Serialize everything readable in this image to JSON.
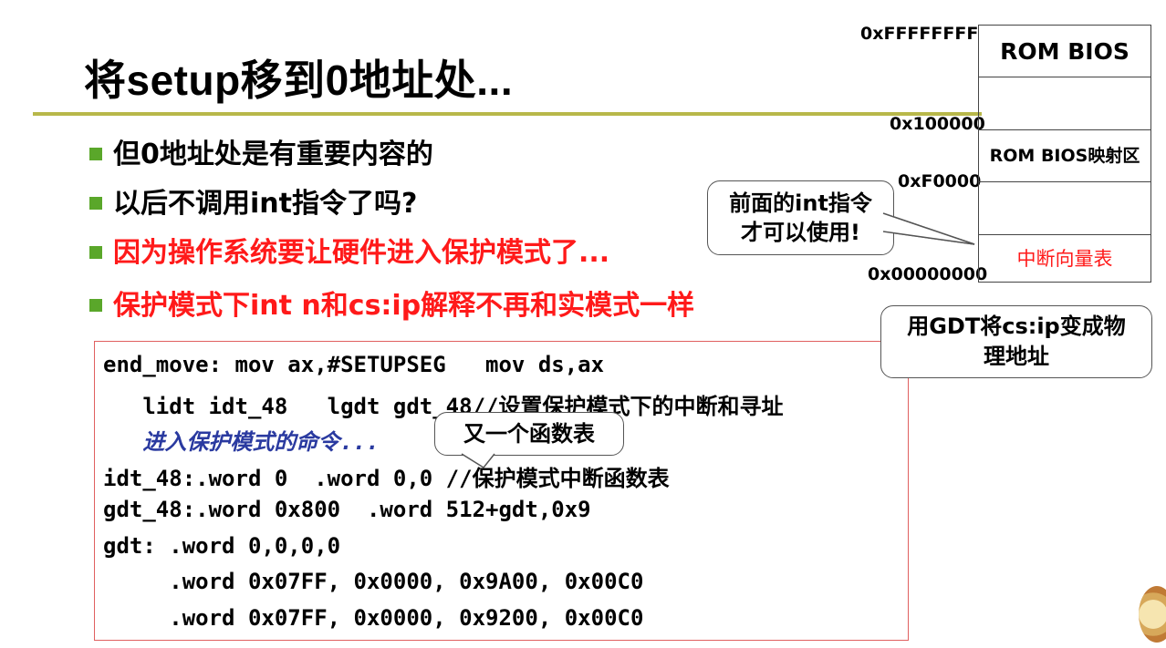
{
  "title": "将setup移到0地址处...",
  "bullets": [
    {
      "text": "但0地址处是有重要内容的",
      "color": "#000000"
    },
    {
      "text": "以后不调用int指令了吗?",
      "color": "#000000"
    },
    {
      "text": "因为操作系统要让硬件进入保护模式了...",
      "color": "#ff1a1a"
    },
    {
      "text": "保护模式下int n和cs:ip解释不再和实模式一样",
      "color": "#ff1a1a"
    }
  ],
  "code": {
    "line1": "end_move: mov ax,#SETUPSEG   mov ds,ax",
    "line2": "   lidt idt_48   lgdt gdt_48//设置保护模式下的中断和寻址",
    "line3": "   进入保护模式的命令...",
    "line4": "idt_48:.word 0  .word 0,0 //保护模式中断函数表",
    "line5": "gdt_48:.word 0x800  .word 512+gdt,0x9",
    "line6": "gdt: .word 0,0,0,0",
    "line7": "     .word 0x07FF, 0x0000, 0x9A00, 0x00C0",
    "line8": "     .word 0x07FF, 0x0000, 0x9200, 0x00C0"
  },
  "callouts": {
    "int_usable": [
      "前面的int指令",
      "才可以使用!"
    ],
    "another_table": "又一个函数表",
    "gdt_note": [
      "用GDT将cs:ip变成物",
      "理地址"
    ]
  },
  "memory_map": {
    "addresses": {
      "top": "0xFFFFFFFF",
      "a100000": "0x100000",
      "aF0000": "0xF0000",
      "zero": "0x00000000"
    },
    "cells": {
      "rom_bios": "ROM BIOS",
      "rom_bios_mapped": "ROM BIOS映射区",
      "ivt": "中断向量表"
    },
    "ivt_color": "#ff1a1a"
  }
}
